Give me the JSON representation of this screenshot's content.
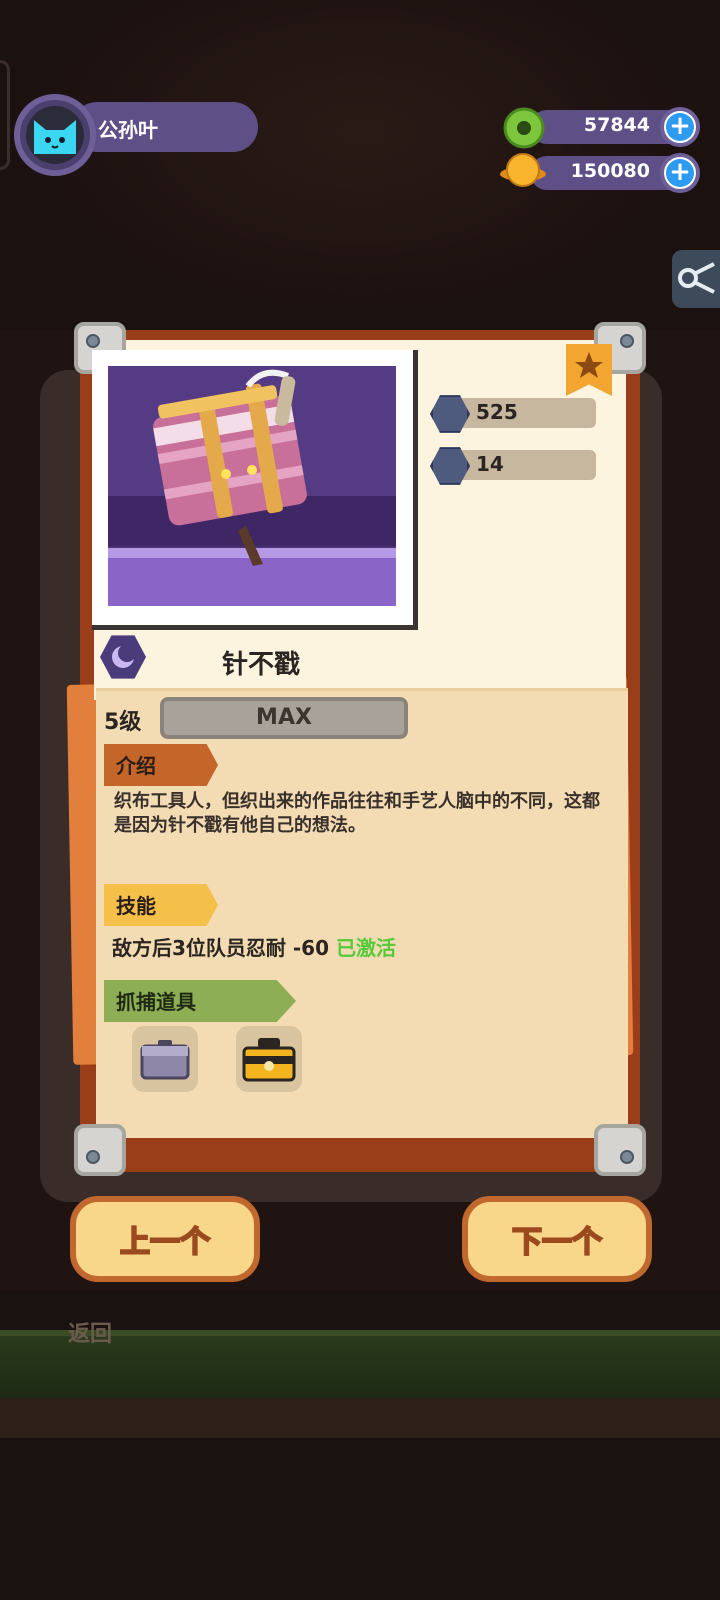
{
  "player": {
    "name": "公孙叶"
  },
  "currency": {
    "green_value": "57844",
    "gold_value": "150080"
  },
  "monster": {
    "name": "针不戳",
    "stat_attack": "525",
    "stat_defense": "14",
    "level_label": "5级",
    "level_bar_text": "MAX"
  },
  "sections": {
    "intro_title": "介绍",
    "intro_text": "织布工具人，但织出来的作品往往和手艺人脑中的不同，这都是因为针不戳有他自己的想法。",
    "skill_title": "技能",
    "skill_text": "敌方后3位队员忍耐 -60",
    "skill_status": "已激活",
    "capture_title": "抓捕道具"
  },
  "nav": {
    "prev_label": "上一个",
    "next_label": "下一个",
    "back_label": "返回"
  },
  "colors": {
    "bg": "#1f1412",
    "panel_purple": "#5f4f87",
    "paper": "#fcf4df",
    "intro_tag": "#c4652a",
    "skill_tag": "#f4c04a",
    "capture_tag": "#8dae55",
    "active_green": "#56c93b",
    "button_fill": "#f9d78a",
    "button_border": "#c0682e"
  }
}
